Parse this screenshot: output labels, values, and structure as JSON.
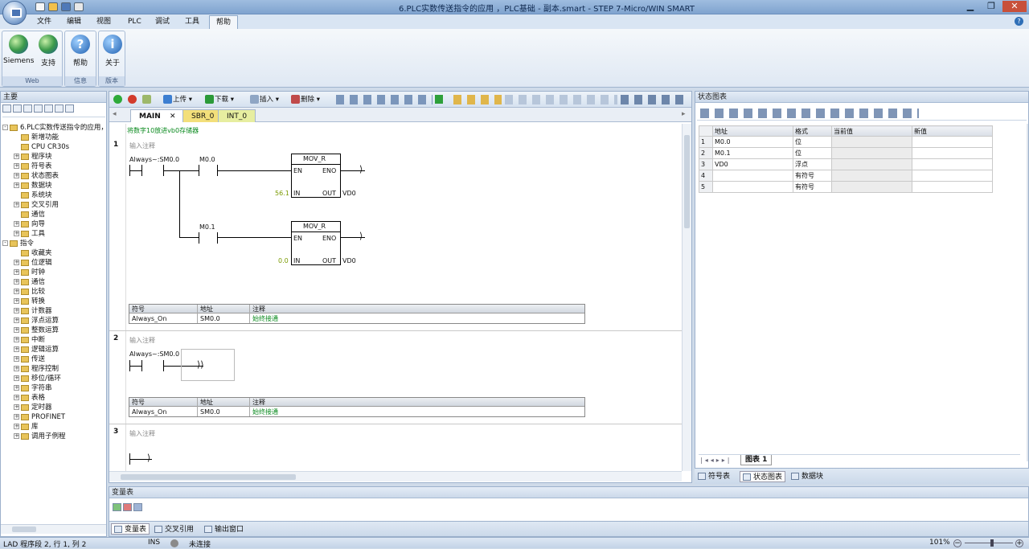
{
  "window": {
    "title": "6.PLC实数传送指令的应用 ，PLC基础 - 副本.smart - STEP 7-Micro/WIN SMART"
  },
  "menu": [
    "文件",
    "编辑",
    "视图",
    "PLC",
    "调试",
    "工具",
    "帮助"
  ],
  "ribbon": {
    "groups": [
      {
        "label": "Web",
        "buttons": [
          "Siemens",
          "支持"
        ]
      },
      {
        "label": "信息",
        "buttons": [
          "帮助"
        ]
      },
      {
        "label": "版本",
        "buttons": [
          "关于"
        ]
      }
    ]
  },
  "left_pane": {
    "title": "主要",
    "tree": [
      {
        "label": "6.PLC实数传送指令的应用，",
        "level": 0,
        "exp": "-"
      },
      {
        "label": "新增功能",
        "level": 1
      },
      {
        "label": "CPU CR30s",
        "level": 1
      },
      {
        "label": "程序块",
        "level": 1,
        "exp": "+"
      },
      {
        "label": "符号表",
        "level": 1,
        "exp": "+"
      },
      {
        "label": "状态图表",
        "level": 1,
        "exp": "+"
      },
      {
        "label": "数据块",
        "level": 1,
        "exp": "+"
      },
      {
        "label": "系统块",
        "level": 1
      },
      {
        "label": "交叉引用",
        "level": 1,
        "exp": "+"
      },
      {
        "label": "通信",
        "level": 1
      },
      {
        "label": "向导",
        "level": 1,
        "exp": "+"
      },
      {
        "label": "工具",
        "level": 1,
        "exp": "+"
      },
      {
        "label": "指令",
        "level": 0,
        "exp": "-"
      },
      {
        "label": "收藏夹",
        "level": 1
      },
      {
        "label": "位逻辑",
        "level": 1,
        "exp": "+"
      },
      {
        "label": "时钟",
        "level": 1,
        "exp": "+"
      },
      {
        "label": "通信",
        "level": 1,
        "exp": "+"
      },
      {
        "label": "比较",
        "level": 1,
        "exp": "+"
      },
      {
        "label": "转换",
        "level": 1,
        "exp": "+"
      },
      {
        "label": "计数器",
        "level": 1,
        "exp": "+"
      },
      {
        "label": "浮点运算",
        "level": 1,
        "exp": "+"
      },
      {
        "label": "整数运算",
        "level": 1,
        "exp": "+"
      },
      {
        "label": "中断",
        "level": 1,
        "exp": "+"
      },
      {
        "label": "逻辑运算",
        "level": 1,
        "exp": "+"
      },
      {
        "label": "传送",
        "level": 1,
        "exp": "+"
      },
      {
        "label": "程序控制",
        "level": 1,
        "exp": "+"
      },
      {
        "label": "移位/循环",
        "level": 1,
        "exp": "+"
      },
      {
        "label": "字符串",
        "level": 1,
        "exp": "+"
      },
      {
        "label": "表格",
        "level": 1,
        "exp": "+"
      },
      {
        "label": "定时器",
        "level": 1,
        "exp": "+"
      },
      {
        "label": "PROFINET",
        "level": 1,
        "exp": "+"
      },
      {
        "label": "库",
        "level": 1,
        "exp": "+"
      },
      {
        "label": "调用子例程",
        "level": 1,
        "exp": "+"
      }
    ]
  },
  "toolbar": {
    "upload": "上传",
    "download": "下载",
    "insert": "插入",
    "delete": "删除"
  },
  "tabs": [
    "MAIN",
    "SBR_0",
    "INT_0"
  ],
  "program": {
    "title_comment": "将数字10放进vb0存储器",
    "comment_placeholder": "输入注释",
    "network1": {
      "num": "1",
      "contact1": "Always~:SM0.0",
      "contact2": "M0.0",
      "contact3": "M0.1",
      "box1": {
        "title": "MOV_R",
        "en": "EN",
        "eno": "ENO",
        "in": "IN",
        "out": "OUT",
        "in_val": "56.1",
        "out_val": "VD0"
      },
      "box2": {
        "title": "MOV_R",
        "en": "EN",
        "eno": "ENO",
        "in": "IN",
        "out": "OUT",
        "in_val": "0.0",
        "out_val": "VD0"
      },
      "symbols": {
        "headers": [
          "符号",
          "地址",
          "注释"
        ],
        "row": [
          "Always_On",
          "SM0.0",
          "始终接通"
        ]
      }
    },
    "network2": {
      "num": "2",
      "contact1": "Always~:SM0.0",
      "symbols": {
        "headers": [
          "符号",
          "地址",
          "注释"
        ],
        "row": [
          "Always_On",
          "SM0.0",
          "始终接通"
        ]
      }
    },
    "network3": {
      "num": "3"
    }
  },
  "status_chart": {
    "title": "状态图表",
    "headers": [
      "地址",
      "格式",
      "当前值",
      "新值"
    ],
    "rows": [
      [
        "1",
        "M0.0",
        "位"
      ],
      [
        "2",
        "M0.1",
        "位"
      ],
      [
        "3",
        "VD0",
        "浮点"
      ],
      [
        "4",
        "",
        "有符号"
      ],
      [
        "5",
        "",
        "有符号"
      ]
    ],
    "sheet_tab": "图表 1",
    "bottom_tabs": [
      "符号表",
      "状态图表",
      "数据块"
    ]
  },
  "var_pane": {
    "title": "变量表",
    "tabs": [
      "变量表",
      "交叉引用",
      "输出窗口"
    ]
  },
  "statusbar": {
    "position": "LAD 程序段 2, 行 1, 列 2",
    "mode": "INS",
    "connection": "未连接",
    "zoom": "101%"
  },
  "colors": {
    "accent": "#2f6fb7",
    "green_text": "#0a8a1e",
    "value_text": "#7a9a00"
  }
}
